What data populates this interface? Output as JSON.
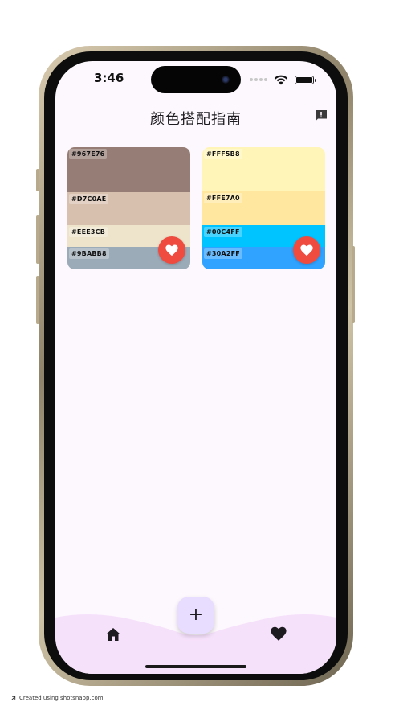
{
  "status_bar": {
    "time": "3:46",
    "signal_icon": "signal-dots-icon",
    "wifi_icon": "wifi-icon",
    "battery_icon": "battery-icon",
    "battery_level": 1.0
  },
  "header": {
    "title": "颜色搭配指南",
    "feedback_icon": "feedback-icon"
  },
  "palettes": [
    {
      "swatches": [
        {
          "hex": "#967E76",
          "color": "#967E76"
        },
        {
          "hex": "#D7C0AE",
          "color": "#D7C0AE"
        },
        {
          "hex": "#EEE3CB",
          "color": "#EEE3CB"
        },
        {
          "hex": "#9BABB8",
          "color": "#9BABB8"
        }
      ],
      "favorite_icon": "heart-icon"
    },
    {
      "swatches": [
        {
          "hex": "#FFF5B8",
          "color": "#FFF5B8"
        },
        {
          "hex": "#FFE7A0",
          "color": "#FFE7A0"
        },
        {
          "hex": "#00C4FF",
          "color": "#00C4FF"
        },
        {
          "hex": "#30A2FF",
          "color": "#30A2FF"
        }
      ],
      "favorite_icon": "heart-icon"
    }
  ],
  "bottom_nav": {
    "home_icon": "home-icon",
    "favorites_icon": "heart-icon",
    "add_button_label": "+"
  },
  "colors": {
    "background": "#FDF8FD",
    "nav_bar": "#F6E1FB",
    "fab": "#E9DDFF",
    "favorite_button": "#EF4B3F"
  },
  "footer": {
    "credit": "Created using shotsnapp.com"
  }
}
